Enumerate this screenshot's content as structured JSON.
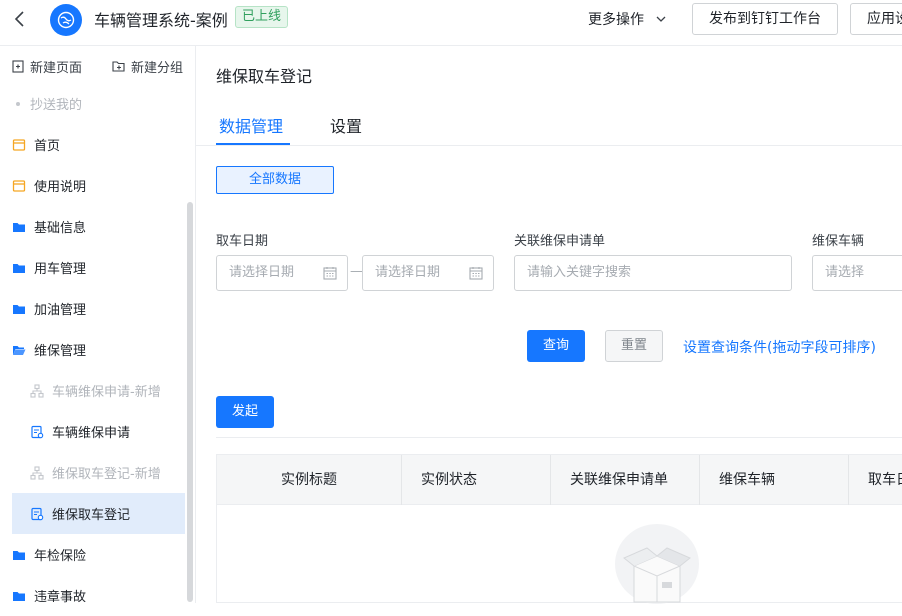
{
  "header": {
    "app_title": "车辆管理系统-案例",
    "status_badge": "已上线",
    "more_ops": "更多操作",
    "publish_btn": "发布到钉钉工作台",
    "app_settings_btn": "应用设"
  },
  "sidebar": {
    "new_page": "新建页面",
    "new_group": "新建分组",
    "items": [
      {
        "label": "抄送我的",
        "type": "dot"
      },
      {
        "label": "首页",
        "type": "page"
      },
      {
        "label": "使用说明",
        "type": "page"
      },
      {
        "label": "基础信息",
        "type": "folder"
      },
      {
        "label": "用车管理",
        "type": "folder"
      },
      {
        "label": "加油管理",
        "type": "folder"
      },
      {
        "label": "维保管理",
        "type": "folder-open"
      },
      {
        "label": "车辆维保申请-新增",
        "type": "sub-muted"
      },
      {
        "label": "车辆维保申请",
        "type": "sub"
      },
      {
        "label": "维保取车登记-新增",
        "type": "sub-muted"
      },
      {
        "label": "维保取车登记",
        "type": "sub-active"
      },
      {
        "label": "年检保险",
        "type": "folder"
      },
      {
        "label": "违章事故",
        "type": "folder"
      }
    ]
  },
  "main": {
    "page_title": "维保取车登记",
    "tabs": [
      "数据管理",
      "设置"
    ],
    "active_tab": "数据管理",
    "all_data_btn": "全部数据",
    "filters": {
      "pickup_date_label": "取车日期",
      "date_start_placeholder": "请选择日期",
      "date_end_placeholder": "请选择日期",
      "date_separator": "—",
      "related_label": "关联维保申请单",
      "related_placeholder": "请输入关键字搜索",
      "vehicle_label": "维保车辆",
      "vehicle_placeholder": "请选择"
    },
    "query_btn": "查询",
    "reset_btn": "重置",
    "config_link": "设置查询条件(拖动字段可排序)",
    "initiate_btn": "发起",
    "table_headers": [
      "实例标题",
      "实例状态",
      "关联维保申请单",
      "维保车辆",
      "取车日"
    ]
  },
  "colors": {
    "primary": "#1677ff",
    "badge_green": "#31a05e",
    "active_bg": "#e1ecfb",
    "folder_blue": "#1677ff",
    "page_orange": "#f5a623"
  }
}
